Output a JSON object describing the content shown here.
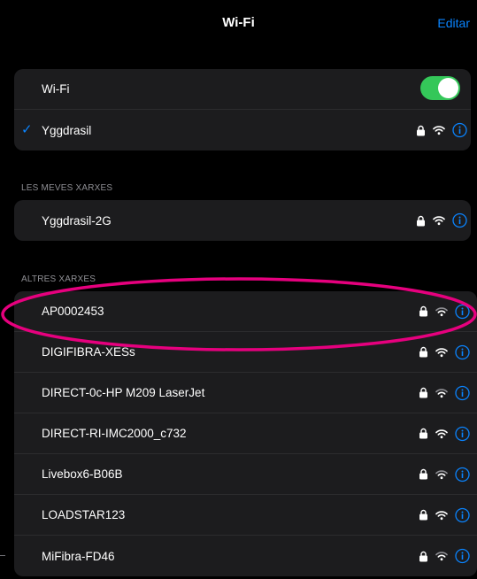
{
  "nav": {
    "title": "Wi-Fi",
    "edit_label": "Editar"
  },
  "wifi_toggle": {
    "label": "Wi-Fi",
    "on": true,
    "on_color": "#34c759"
  },
  "connected": {
    "check": "✓",
    "name": "Yggdrasil",
    "secured": true
  },
  "my_networks": {
    "header": "LES MEVES XARXES",
    "items": [
      {
        "name": "Yggdrasil-2G",
        "secured": true
      }
    ]
  },
  "other_networks": {
    "header": "ALTRES XARXES",
    "items": [
      {
        "name": "AP0002453",
        "secured": true,
        "highlighted": true
      },
      {
        "name": "DIGIFIBRA-XESs",
        "secured": true
      },
      {
        "name": "DIRECT-0c-HP M209 LaserJet",
        "secured": true
      },
      {
        "name": "DIRECT-RI-IMC2000_c732",
        "secured": true
      },
      {
        "name": "Livebox6-B06B",
        "secured": true
      },
      {
        "name": "LOADSTAR123",
        "secured": true
      },
      {
        "name": "MiFibra-FD46",
        "secured": true
      }
    ]
  },
  "colors": {
    "accent": "#0a84ff",
    "group_bg": "#1c1c1e",
    "header_text": "#8e8e93",
    "highlight": "#e6007e"
  },
  "icons": {
    "lock": "lock-icon",
    "wifi": "wifi-signal-icon",
    "info": "info-icon"
  }
}
